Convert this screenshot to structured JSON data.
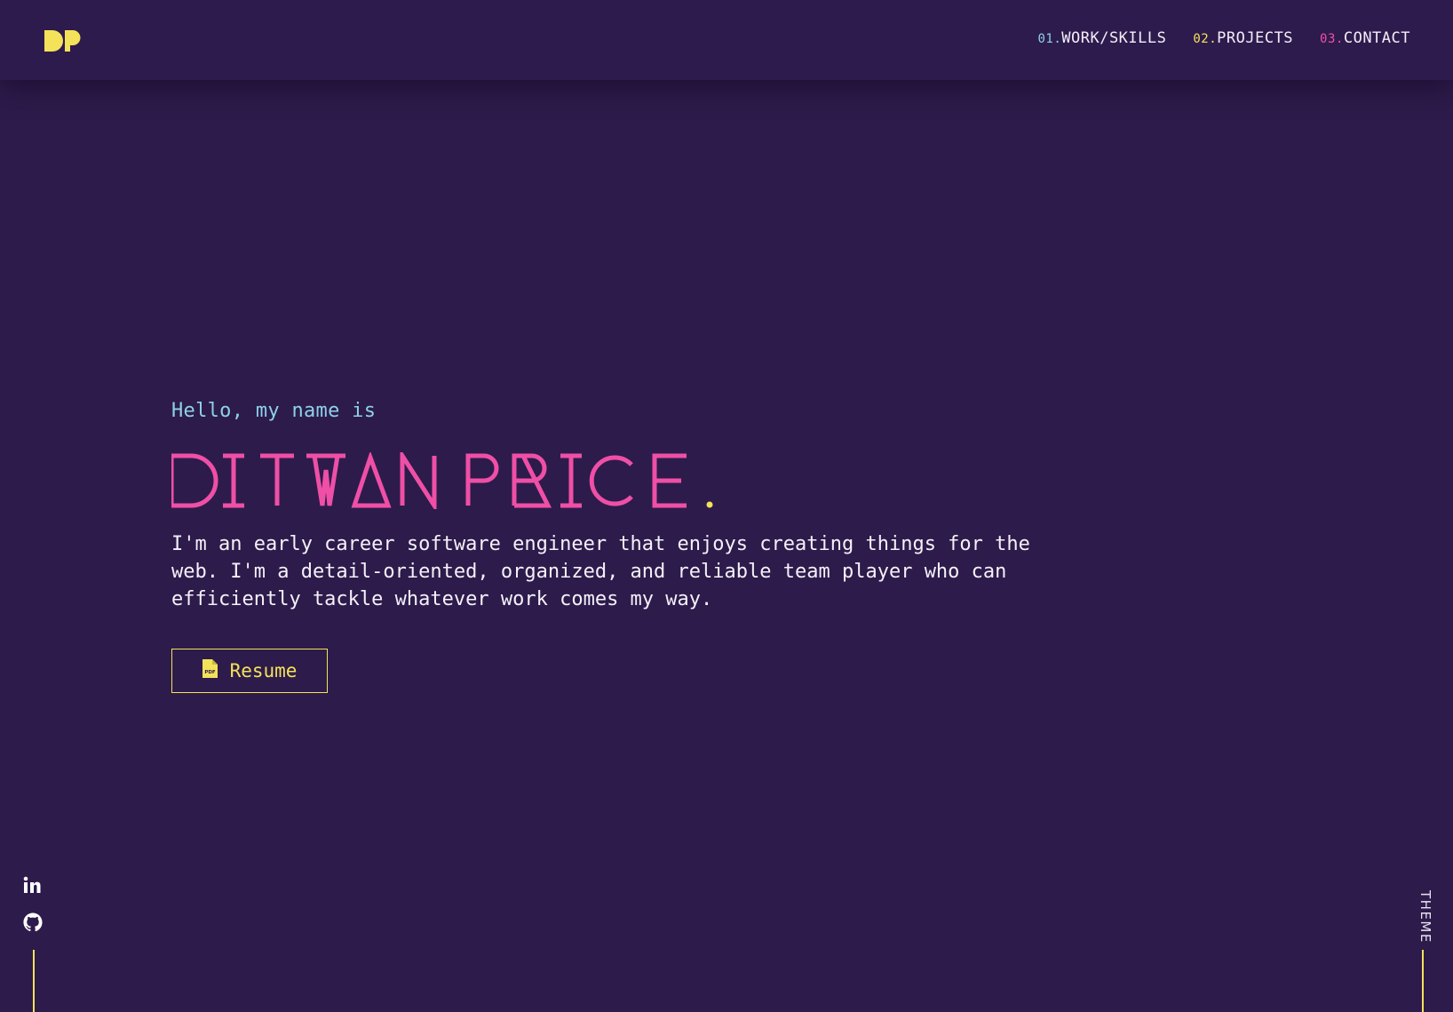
{
  "brand": {
    "logo_text": "DP",
    "logo_color": "#f3e25a"
  },
  "nav": {
    "items": [
      {
        "num": "01.",
        "label": "WORK/SKILLS",
        "num_color": "#8ed0e8"
      },
      {
        "num": "02.",
        "label": "PROJECTS",
        "num_color": "#f3e25a"
      },
      {
        "num": "03.",
        "label": "CONTACT",
        "num_color": "#ef4fa6"
      }
    ]
  },
  "hero": {
    "greeting": "Hello, my name is",
    "name": "DITWAN PRICE",
    "name_color": "#ef4fa6",
    "name_dot": ".",
    "name_dot_color": "#f3e25a",
    "about": "I'm an early career software engineer that enjoys creating things for the web. I'm a detail-oriented, organized, and reliable team player who can efficiently tackle whatever work comes my way.",
    "resume_button": "Resume",
    "resume_icon": "pdf-file-icon"
  },
  "social": [
    {
      "name": "LinkedIn",
      "icon": "linkedin-icon"
    },
    {
      "name": "GitHub",
      "icon": "github-icon"
    }
  ],
  "theme_toggle": "THEME",
  "colors": {
    "background": "#2d1b4b",
    "accent_yellow": "#f3e25a",
    "accent_pink": "#ef4fa6",
    "accent_cyan": "#8ed0e8",
    "text": "#f4f1f8"
  }
}
